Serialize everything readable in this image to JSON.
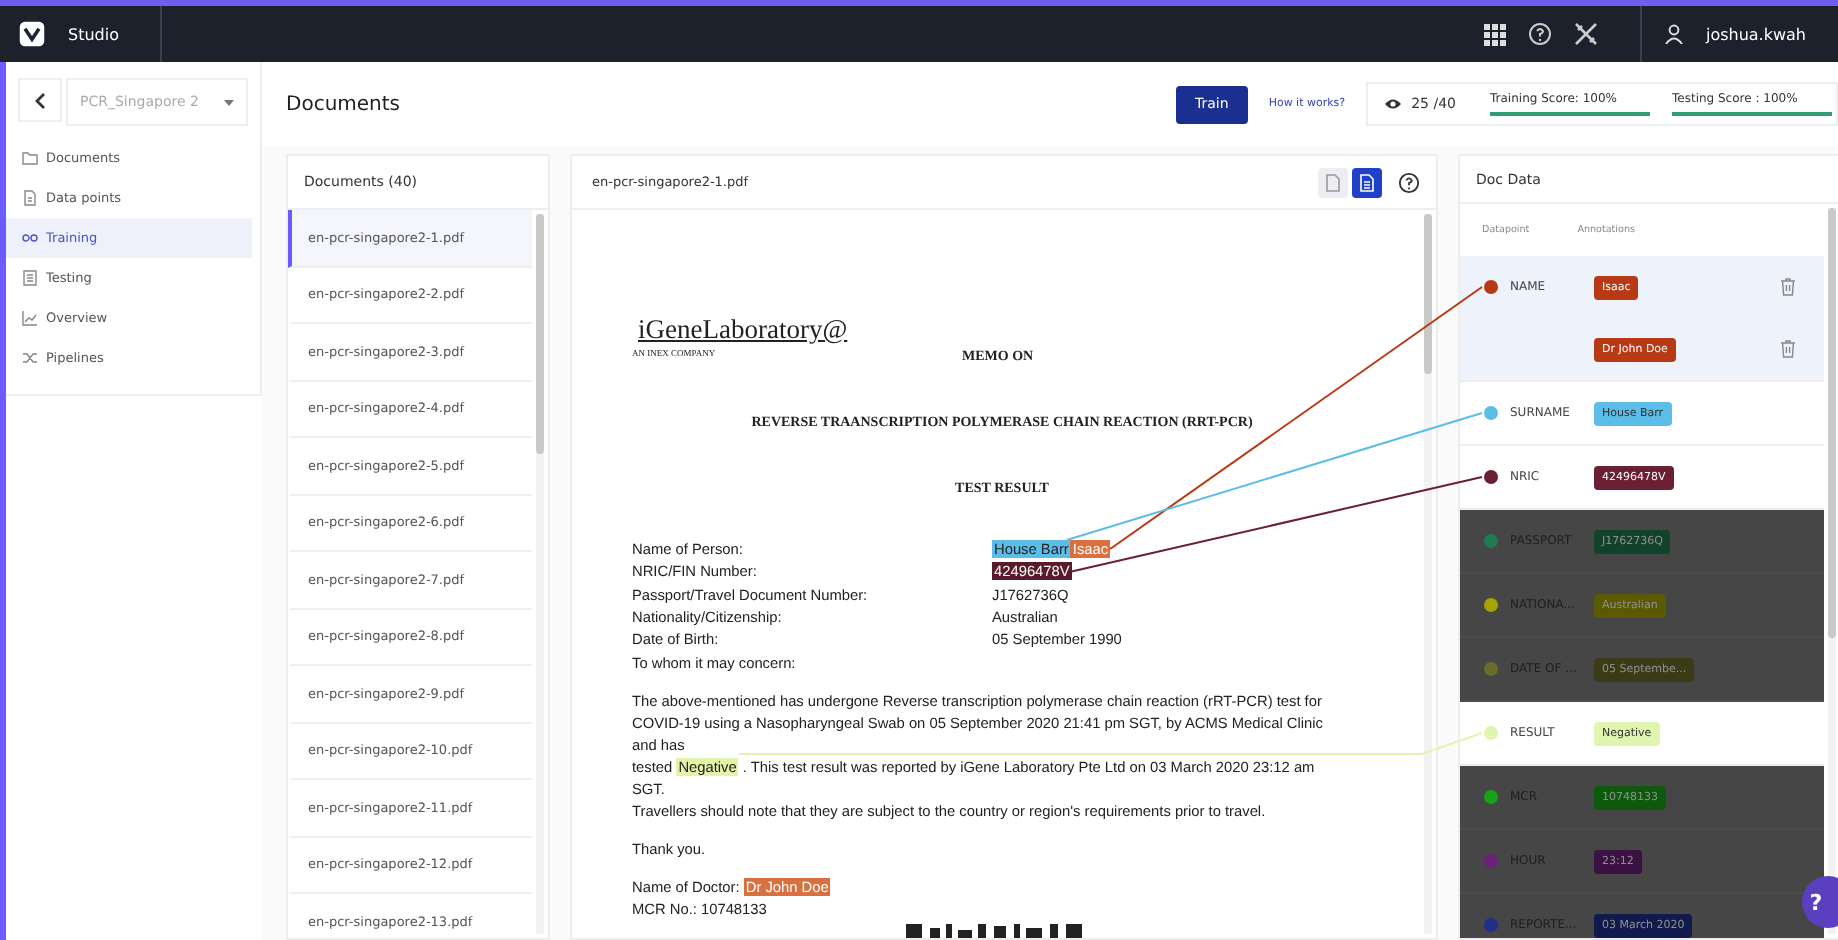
{
  "topbar": {
    "app_name": "Studio",
    "user": "joshua.kwah"
  },
  "sidebar": {
    "project": "PCR_Singapore 2",
    "items": [
      {
        "label": "Documents",
        "selected": false
      },
      {
        "label": "Data points",
        "selected": false
      },
      {
        "label": "Training",
        "selected": true
      },
      {
        "label": "Testing",
        "selected": false
      },
      {
        "label": "Overview",
        "selected": false
      },
      {
        "label": "Pipelines",
        "selected": false
      }
    ]
  },
  "header": {
    "title": "Documents",
    "train_button": "Train",
    "help_link": "How it works?",
    "counter": "25 /40",
    "scores": [
      {
        "label": "Training Score: 100%",
        "level": 1
      },
      {
        "label": "Testing Score : 100%",
        "level": 1
      }
    ]
  },
  "documents": {
    "title": "Documents (40)",
    "items": [
      {
        "name": "en-pcr-singapore2-1.pdf",
        "selected": true
      },
      {
        "name": "en-pcr-singapore2-2.pdf",
        "selected": false
      },
      {
        "name": "en-pcr-singapore2-3.pdf",
        "selected": false
      },
      {
        "name": "en-pcr-singapore2-4.pdf",
        "selected": false
      },
      {
        "name": "en-pcr-singapore2-5.pdf",
        "selected": false
      },
      {
        "name": "en-pcr-singapore2-6.pdf",
        "selected": false
      },
      {
        "name": "en-pcr-singapore2-7.pdf",
        "selected": false
      },
      {
        "name": "en-pcr-singapore2-8.pdf",
        "selected": false
      },
      {
        "name": "en-pcr-singapore2-9.pdf",
        "selected": false
      },
      {
        "name": "en-pcr-singapore2-10.pdf",
        "selected": false
      },
      {
        "name": "en-pcr-singapore2-11.pdf",
        "selected": false
      },
      {
        "name": "en-pcr-singapore2-12.pdf",
        "selected": false
      },
      {
        "name": "en-pcr-singapore2-13.pdf",
        "selected": false
      }
    ]
  },
  "viewer": {
    "filename": "en-pcr-singapore2-1.pdf",
    "page": {
      "logo": "iGeneLaboratory@",
      "logo_sub": "AN INEX COMPANY",
      "memo": "MEMO ON",
      "heading": "REVERSE TRAANSCRIPTION POLYMERASE CHAIN REACTION (RRT-PCR)",
      "subheading": "TEST RESULT",
      "fields": [
        {
          "label": "Name of Person:",
          "value": [
            {
              "text": "House Barr",
              "color": "#5bbde8"
            },
            {
              "text": "Isaac",
              "color": "#d9703f"
            }
          ]
        },
        {
          "label": "NRIC/FIN Number:",
          "value": [
            {
              "text": "42496478V",
              "color": "#5a1a2c"
            }
          ]
        },
        {
          "label": "Passport/Travel Document Number:",
          "value": [
            {
              "text": "J1762736Q"
            }
          ]
        },
        {
          "label": "Nationality/Citizenship:",
          "value": [
            {
              "text": "Australian"
            }
          ]
        },
        {
          "label": "Date of Birth:",
          "value": [
            {
              "text": "05 September 1990"
            }
          ]
        }
      ],
      "greeting": "To whom it may concern:",
      "body_lines": [
        [
          {
            "text": "The above-mentioned has undergone Reverse transcription polymerase chain reaction (rRT-PCR) test for"
          }
        ],
        [
          {
            "text": "COVID-19 using a Nasopharyngeal Swab on 05 September 2020 21:41 pm SGT,  by ACMS Medical Clinic"
          }
        ],
        [
          {
            "text": "and has"
          }
        ],
        [
          {
            "text": "tested "
          },
          {
            "text": "Negative",
            "color": "#e3f3a8"
          },
          {
            "text": " . This test result was reported by iGene Laboratory Pte Ltd on 03 March 2020 23:12 am"
          }
        ],
        [
          {
            "text": "SGT."
          }
        ],
        [
          {
            "text": "Travellers should note that they are subject to the country or region's requirements prior to travel."
          }
        ]
      ],
      "thanks": "Thank you.",
      "doctor": [
        {
          "text": "Name of Doctor: "
        },
        {
          "text": "Dr John Doe",
          "color": "#d9703f"
        }
      ],
      "mcr": "MCR No.: 10748133"
    }
  },
  "doc_data": {
    "title": "Doc Data",
    "columns": [
      "Datapoint",
      "Annotations"
    ],
    "rows": [
      {
        "label": "NAME",
        "color": "#b83a14",
        "annotations": [
          "Isaac",
          "Dr John Doe"
        ],
        "highlighted": true,
        "dimmed": false
      },
      {
        "label": "SURNAME",
        "color": "#5bbde8",
        "annotations": [
          "House Barr"
        ],
        "highlighted": false,
        "dimmed": false
      },
      {
        "label": "NRIC",
        "color": "#6b1f33",
        "annotations": [
          "42496478V"
        ],
        "highlighted": false,
        "dimmed": false
      },
      {
        "label": "PASSPORT",
        "color": "#1f7a4f",
        "annotations": [
          "J1762736Q"
        ],
        "highlighted": false,
        "dimmed": true
      },
      {
        "label": "NATIONA...",
        "color": "#a7a300",
        "annotations": [
          "Australian"
        ],
        "highlighted": false,
        "dimmed": true
      },
      {
        "label": "DATE OF ...",
        "color": "#6b6b2a",
        "annotations": [
          "05 Septembe..."
        ],
        "highlighted": false,
        "dimmed": true
      },
      {
        "label": "RESULT",
        "color": "#e0f5b0",
        "annotations": [
          "Negative"
        ],
        "highlighted": false,
        "dimmed": false
      },
      {
        "label": "MCR",
        "color": "#17a317",
        "annotations": [
          "10748133"
        ],
        "highlighted": false,
        "dimmed": true
      },
      {
        "label": "HOUR",
        "color": "#6b1f7a",
        "annotations": [
          "23:12"
        ],
        "highlighted": false,
        "dimmed": true
      },
      {
        "label": "REPORTE...",
        "color": "#1f2f8a",
        "annotations": [
          "03 March 2020"
        ],
        "highlighted": false,
        "dimmed": true
      }
    ]
  },
  "help_fab": "?"
}
